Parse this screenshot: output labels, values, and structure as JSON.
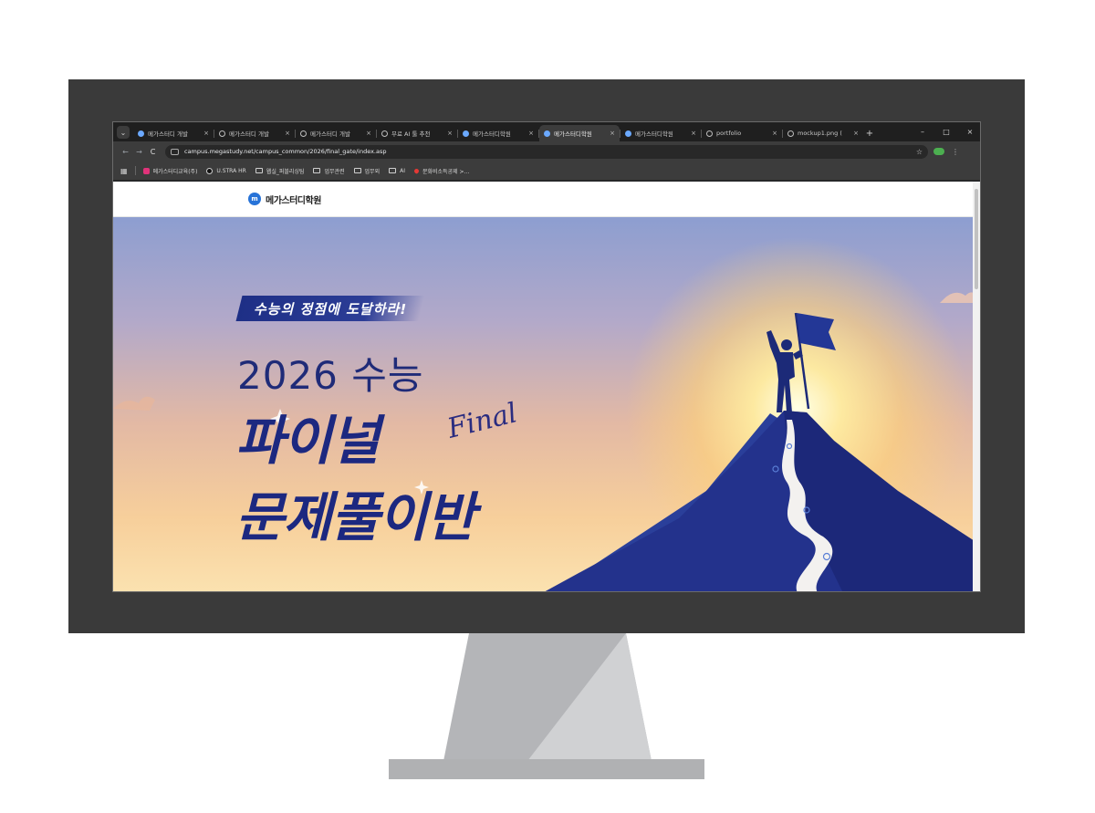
{
  "browser": {
    "tabs": [
      {
        "title": "메가스터디 개발",
        "favicon": "megastudy-icon",
        "active": false
      },
      {
        "title": "메가스터디 개발",
        "favicon": "globe-icon",
        "active": false
      },
      {
        "title": "메가스터디 개발",
        "favicon": "globe-icon",
        "active": false
      },
      {
        "title": "무료 AI 툴 추천",
        "favicon": "globe-icon",
        "active": false
      },
      {
        "title": "메가스터디학원",
        "favicon": "megastudy-icon",
        "active": false
      },
      {
        "title": "메가스터디학원",
        "favicon": "megastudy-icon",
        "active": true
      },
      {
        "title": "메가스터디학원",
        "favicon": "megastudy-icon",
        "active": false
      },
      {
        "title": "portfolio",
        "favicon": "globe-icon",
        "active": false
      },
      {
        "title": "mockup1.png (",
        "favicon": "globe-icon",
        "active": false
      }
    ],
    "close_glyph": "×",
    "new_tab_glyph": "+",
    "window_controls": {
      "minimize": "–",
      "maximize": "□",
      "close": "×"
    },
    "nav": {
      "back": "←",
      "forward": "→",
      "reload": "C"
    },
    "url": "campus.megastudy.net/campus_common/2026/final_gate/index.asp",
    "bookmarks": [
      {
        "label": "메가스터디교육(주)",
        "icon": "pink-square-icon"
      },
      {
        "label": "U.STRA HR",
        "icon": "dark-circle-icon"
      },
      {
        "label": "웹실_퍼블리싱팀",
        "icon": "folder-icon"
      },
      {
        "label": "업무관련",
        "icon": "folder-icon"
      },
      {
        "label": "업무외",
        "icon": "folder-icon"
      },
      {
        "label": "AI",
        "icon": "folder-icon"
      },
      {
        "label": "문화비소득공제 >...",
        "icon": "heart-icon"
      }
    ]
  },
  "site": {
    "logo_text": "메가스터디학원",
    "hero": {
      "slogan": "수능의 정점에 도달하라!",
      "year_line": "2026 수능",
      "title_line1": "파이널",
      "title_line2": "문제풀이반",
      "script_word": "Final"
    }
  },
  "colors": {
    "navy": "#1c2880",
    "accent_blue": "#2773d8",
    "browser_dark": "#1f1f1f"
  }
}
